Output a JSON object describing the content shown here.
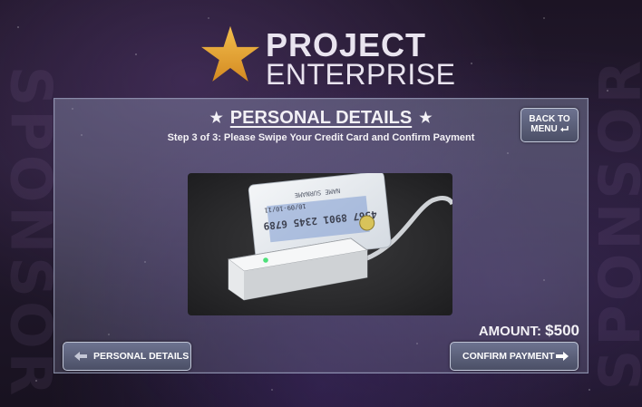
{
  "logo": {
    "line1": "PROJECT",
    "line2": "ENTERPRISE",
    "star_color": "#e8a93a"
  },
  "background": {
    "side_text": "SPONSOR"
  },
  "panel": {
    "title": "PERSONAL DETAILS",
    "title_star": "★",
    "step": "Step 3 of 3:  Please Swipe Your Credit Card and Confirm Payment",
    "back_button": {
      "line1": "BACK TO",
      "line2": "MENU"
    },
    "card": {
      "number": "4567 8901 2345 6789",
      "expiry": "10/09-10/11",
      "name": "NAME SURNAME"
    },
    "amount_label": "AMOUNT:",
    "amount_value": "$500",
    "prev_button": "PERSONAL DETAILS",
    "next_button": "CONFIRM PAYMENT"
  },
  "icons": {
    "prev": "arrow-left-icon",
    "next": "arrow-right-icon",
    "back": "return-arrow-icon"
  }
}
